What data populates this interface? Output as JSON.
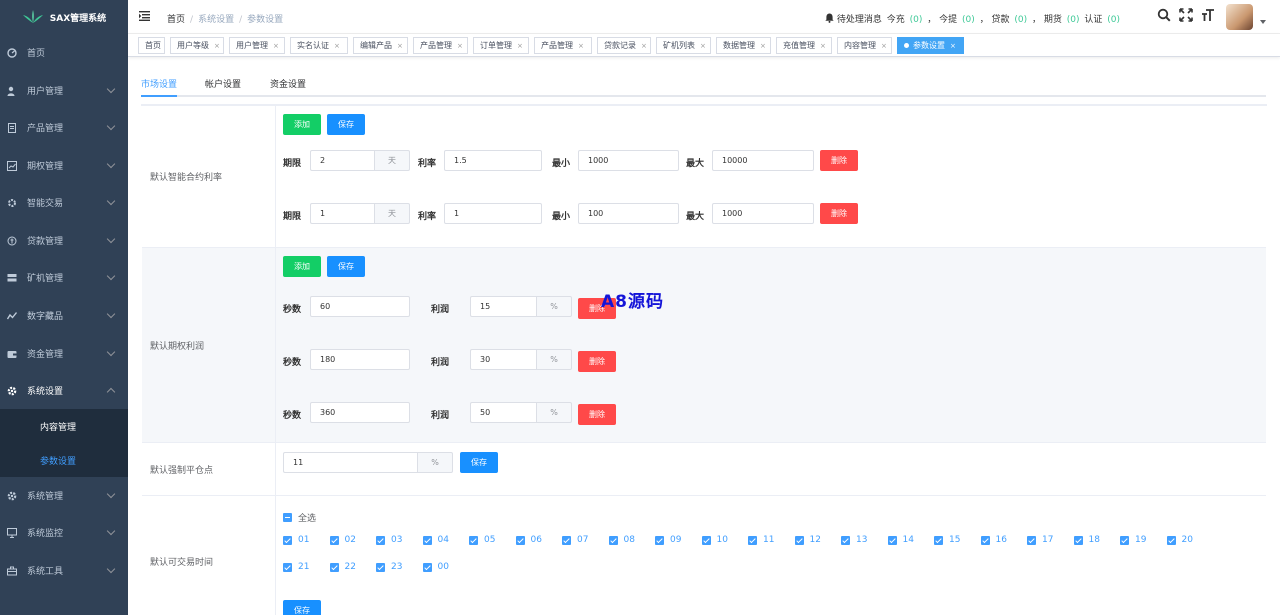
{
  "sidebar": {
    "app_title": "SAX管理系统",
    "menu": [
      {
        "label": "首页",
        "icon": "dashboard-icon"
      },
      {
        "label": "用户管理",
        "icon": "user-icon"
      },
      {
        "label": "产品管理",
        "icon": "document-icon"
      },
      {
        "label": "期权管理",
        "icon": "chart-icon"
      },
      {
        "label": "智能交易",
        "icon": "gear-icon"
      },
      {
        "label": "贷款管理",
        "icon": "money-icon"
      },
      {
        "label": "矿机管理",
        "icon": "server-icon"
      },
      {
        "label": "数字藏品",
        "icon": "trend-icon"
      },
      {
        "label": "资金管理",
        "icon": "wallet-icon"
      },
      {
        "label": "系统设置",
        "icon": "gear-icon"
      },
      {
        "label": "系统管理",
        "icon": "gear-icon"
      },
      {
        "label": "系统监控",
        "icon": "monitor-icon"
      },
      {
        "label": "系统工具",
        "icon": "toolbox-icon"
      }
    ],
    "submenu": [
      {
        "label": "内容管理"
      },
      {
        "label": "参数设置"
      }
    ]
  },
  "navbar": {
    "breadcrumb": [
      "首页",
      "系统设置",
      "参数设置"
    ],
    "notice_label": "待处理消息",
    "notice_items": [
      {
        "label": "今充",
        "count": "(0)"
      },
      {
        "label": "今提",
        "count": "(0)"
      },
      {
        "label": "贷款",
        "count": "(0)"
      },
      {
        "label": "期货",
        "count": "(0)"
      },
      {
        "label": "认证",
        "count": "(0)"
      }
    ]
  },
  "tags": [
    "首页",
    "用户等级",
    "用户管理",
    "实名认证",
    "编辑产品",
    "产品管理",
    "订单管理",
    "产品管理",
    "贷款记录",
    "矿机列表",
    "数据管理",
    "充值管理",
    "内容管理",
    "参数设置"
  ],
  "tabs": [
    "市场设置",
    "帐户设置",
    "资金设置"
  ],
  "buttons": {
    "add": "添加",
    "save": "保存",
    "delete": "删除"
  },
  "contract": {
    "label": "默认智能合约利率",
    "f_period": "期限",
    "f_rate": "利率",
    "f_min": "最小",
    "f_max": "最大",
    "unit_day": "天",
    "rows": [
      {
        "period": "2",
        "rate": "1.5",
        "min": "1000",
        "max": "10000"
      },
      {
        "period": "1",
        "rate": "1",
        "min": "100",
        "max": "1000"
      }
    ]
  },
  "option": {
    "label": "默认期权利润",
    "f_seconds": "秒数",
    "f_profit": "利润",
    "unit": "%",
    "rows": [
      {
        "seconds": "60",
        "profit": "15"
      },
      {
        "seconds": "180",
        "profit": "30"
      },
      {
        "seconds": "360",
        "profit": "50"
      }
    ]
  },
  "liquidation": {
    "label": "默认强制平仓点",
    "value": "11",
    "unit": "%"
  },
  "hours": {
    "label": "默认可交易时间",
    "select_all": "全选",
    "items": [
      "01",
      "02",
      "03",
      "04",
      "05",
      "06",
      "07",
      "08",
      "09",
      "10",
      "11",
      "12",
      "13",
      "14",
      "15",
      "16",
      "17",
      "18",
      "19",
      "20",
      "21",
      "22",
      "23",
      "00"
    ]
  },
  "watermark": "A8源码"
}
